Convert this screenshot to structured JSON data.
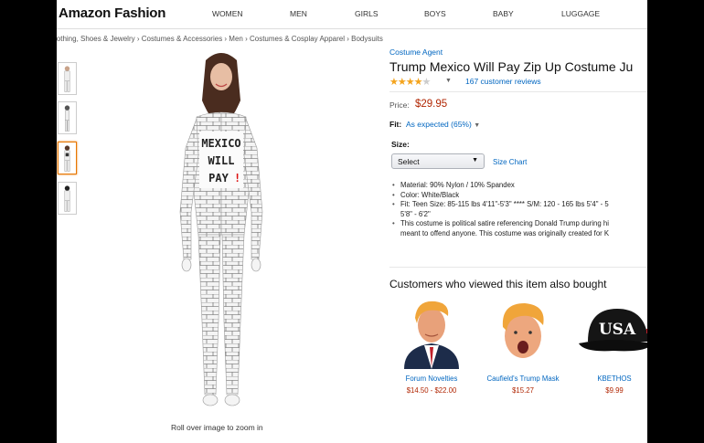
{
  "header": {
    "logo": "Amazon Fashion",
    "nav": [
      "WOMEN",
      "MEN",
      "GIRLS",
      "BOYS",
      "BABY",
      "LUGGAGE"
    ]
  },
  "breadcrumb": "lothing, Shoes & Jewelry › Costumes & Accessories › Men › Costumes & Cosplay Apparel › Bodysuits",
  "gallery": {
    "zoom_hint": "Roll over image to zoom in",
    "costume_text": [
      "MEXICO",
      "WILL",
      "PAY"
    ],
    "costume_exclaim": "!"
  },
  "product": {
    "brand": "Costume Agent",
    "title": "Trump Mexico Will Pay Zip Up Costume Ju",
    "rating_stars": 3.5,
    "rating_max": 5,
    "reviews": "167 customer reviews",
    "price_label": "Price:",
    "price": "$29.95",
    "fit_label": "Fit:",
    "fit_value": "As expected (65%)",
    "size_label": "Size:",
    "size_select": "Select",
    "size_chart": "Size Chart",
    "bullets": [
      "Material: 90% Nylon / 10% Spandex",
      "Color: White/Black",
      "Fit: Teen Size: 85-115 lbs 4'11\"-5'3\" **** S/M: 120 - 165 lbs 5'4\" - 5",
      "This costume is political satire referencing Donald Trump during hi"
    ],
    "bullet_cont_3": "5'8\" - 6'2\"",
    "bullet_cont_4": "meant to offend anyone. This costume was originally created for K"
  },
  "also_bought": {
    "title": "Customers who viewed this item also bought",
    "items": [
      {
        "name": "Forum Novelties",
        "price": "$14.50 - $22.00"
      },
      {
        "name": "Caufield's Trump Mask",
        "price": "$15.27"
      },
      {
        "name": "KBETHOS",
        "price": "$9.99",
        "cap_text": "USA"
      }
    ]
  },
  "colors": {
    "link": "#0066c0",
    "price": "#b12704",
    "star": "#f4a41d",
    "active_thumb": "#e77600"
  }
}
